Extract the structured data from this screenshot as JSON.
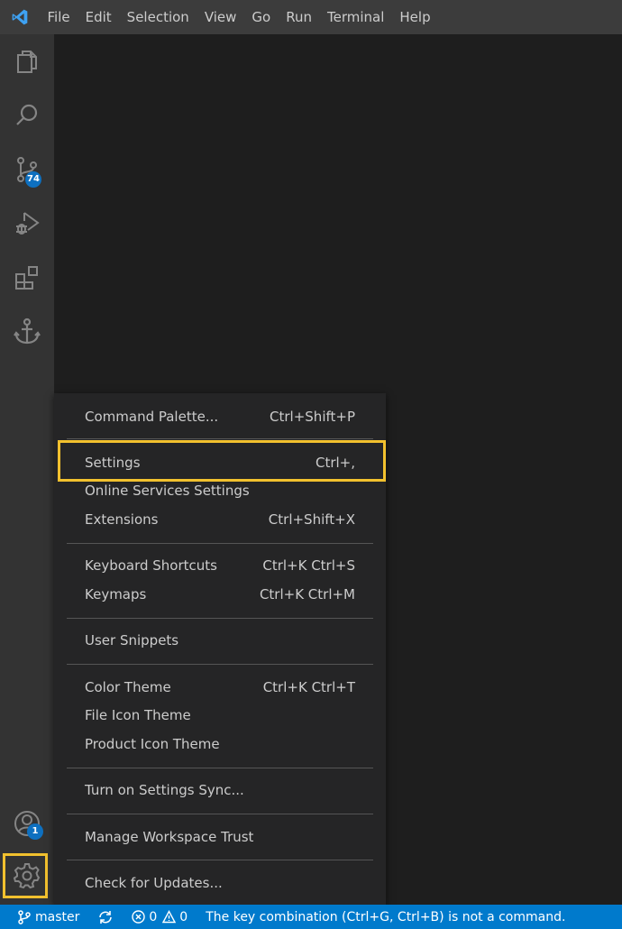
{
  "menubar": {
    "items": [
      "File",
      "Edit",
      "Selection",
      "View",
      "Go",
      "Run",
      "Terminal",
      "Help"
    ]
  },
  "activitybar": {
    "items": [
      {
        "name": "explorer",
        "icon": "files-icon"
      },
      {
        "name": "search",
        "icon": "search-icon"
      },
      {
        "name": "source-control",
        "icon": "source-control-icon",
        "badge": "74"
      },
      {
        "name": "run-and-debug",
        "icon": "debug-icon"
      },
      {
        "name": "extensions",
        "icon": "extensions-icon"
      },
      {
        "name": "anchor",
        "icon": "anchor-icon"
      }
    ],
    "accounts_badge": "1",
    "accent_color": "#0e70c0"
  },
  "context_menu": {
    "groups": [
      [
        {
          "label": "Command Palette...",
          "shortcut": "Ctrl+Shift+P"
        }
      ],
      [
        {
          "label": "Settings",
          "shortcut": "Ctrl+,",
          "highlighted": true
        },
        {
          "label": "Online Services Settings",
          "shortcut": ""
        },
        {
          "label": "Extensions",
          "shortcut": "Ctrl+Shift+X"
        }
      ],
      [
        {
          "label": "Keyboard Shortcuts",
          "shortcut": "Ctrl+K Ctrl+S"
        },
        {
          "label": "Keymaps",
          "shortcut": "Ctrl+K Ctrl+M"
        }
      ],
      [
        {
          "label": "User Snippets",
          "shortcut": ""
        }
      ],
      [
        {
          "label": "Color Theme",
          "shortcut": "Ctrl+K Ctrl+T"
        },
        {
          "label": "File Icon Theme",
          "shortcut": ""
        },
        {
          "label": "Product Icon Theme",
          "shortcut": ""
        }
      ],
      [
        {
          "label": "Turn on Settings Sync...",
          "shortcut": ""
        }
      ],
      [
        {
          "label": "Manage Workspace Trust",
          "shortcut": ""
        }
      ],
      [
        {
          "label": "Check for Updates...",
          "shortcut": ""
        }
      ]
    ],
    "highlight_color": "#f2c12e"
  },
  "statusbar": {
    "branch": "master",
    "errors": "0",
    "warnings": "0",
    "message": "The key combination (Ctrl+G, Ctrl+B) is not a command.",
    "color": "#007acc"
  }
}
